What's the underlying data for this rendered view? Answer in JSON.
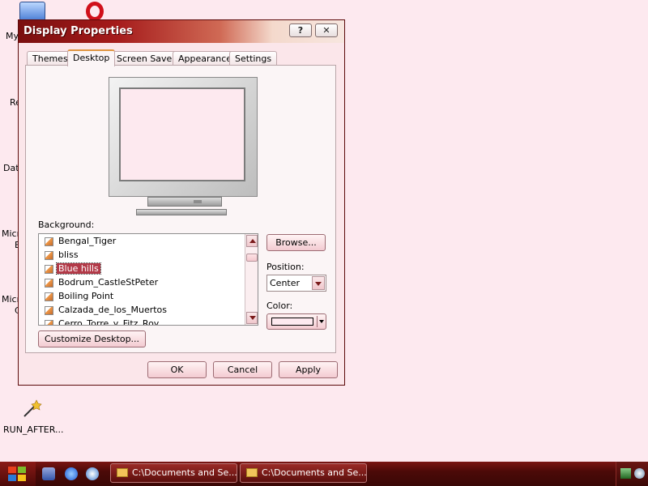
{
  "desktop": {
    "icons": [
      {
        "label": "My"
      },
      {
        "label": "Re"
      },
      {
        "label": "Dat"
      },
      {
        "label": "Micr"
      },
      {
        "label": "B"
      },
      {
        "label": "Micr"
      },
      {
        "label": "C"
      },
      {
        "label": "RUN_AFTER..."
      }
    ]
  },
  "dialog": {
    "title": "Display Properties",
    "help_label": "?",
    "close_label": "✕",
    "tabs": [
      {
        "label": "Themes"
      },
      {
        "label": "Desktop"
      },
      {
        "label": "Screen Saver"
      },
      {
        "label": "Appearance"
      },
      {
        "label": "Settings"
      }
    ],
    "active_tab": "Desktop",
    "background_label": "Background:",
    "backgrounds": [
      {
        "label": "Bengal_Tiger"
      },
      {
        "label": "bliss"
      },
      {
        "label": "Blue hills"
      },
      {
        "label": "Bodrum_CastleStPeter"
      },
      {
        "label": "Boiling Point"
      },
      {
        "label": "Calzada_de_los_Muertos"
      },
      {
        "label": "Cerro_Torre_y_Fitz_Roy"
      }
    ],
    "selected_background": "Blue hills",
    "browse_label": "Browse...",
    "position_label": "Position:",
    "position_value": "Center",
    "color_label": "Color:",
    "color_value": "#fde9ef",
    "customize_label": "Customize Desktop...",
    "ok_label": "OK",
    "cancel_label": "Cancel",
    "apply_label": "Apply"
  },
  "taskbar": {
    "tasks": [
      {
        "label": "C:\\Documents and Se..."
      },
      {
        "label": "C:\\Documents and Se..."
      }
    ]
  },
  "colors": {
    "desktop_bg": "#fde9ef",
    "title_bar": "#a51b1b",
    "selection": "#b23a48",
    "taskbar": "#4c0a08"
  }
}
